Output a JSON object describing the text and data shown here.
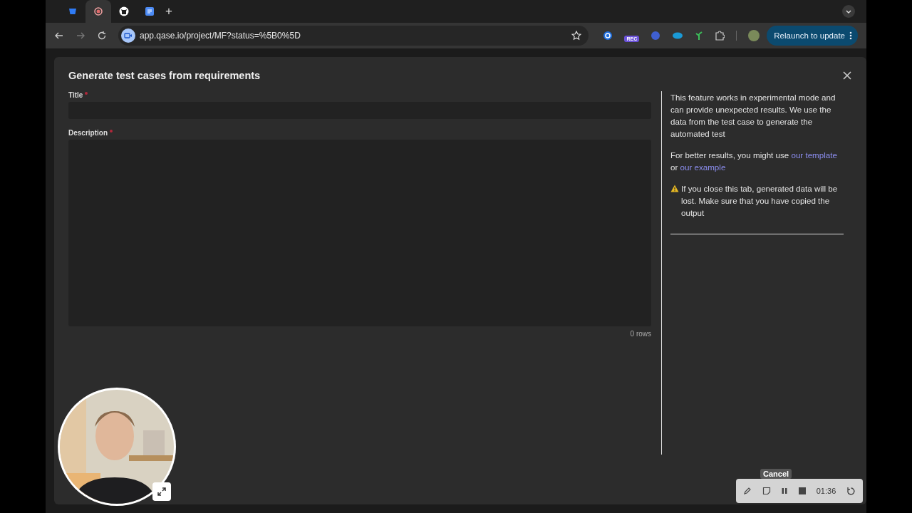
{
  "browser": {
    "tabs": [
      {
        "selected": false
      },
      {
        "selected": true
      },
      {
        "selected": false
      },
      {
        "selected": false
      }
    ],
    "new_tab": "+",
    "url": "app.qase.io/project/MF?status=%5B0%5D",
    "extension_badge": "REC",
    "relaunch": "Relaunch to update"
  },
  "modal": {
    "title": "Generate test cases from requirements",
    "fields": [
      {
        "kind": "input",
        "label": "Title",
        "required": true
      },
      {
        "kind": "textarea",
        "label": "Description",
        "required": true
      }
    ],
    "row_count": "0 rows",
    "notes": [
      {
        "kind": "text",
        "text": "This feature works in experimental mode and can provide unexpected results. We use the data from the test case to generate the automated test"
      },
      {
        "kind": "links",
        "text": "For better results, you might use",
        "link": "our template",
        "between": "or",
        "link2": "our example"
      },
      {
        "kind": "warning",
        "text": "If you close this tab, generated data will be lost. Make sure that you have copied the output"
      }
    ]
  },
  "recorder": {
    "cancel": "Cancel",
    "time": "01:36"
  }
}
